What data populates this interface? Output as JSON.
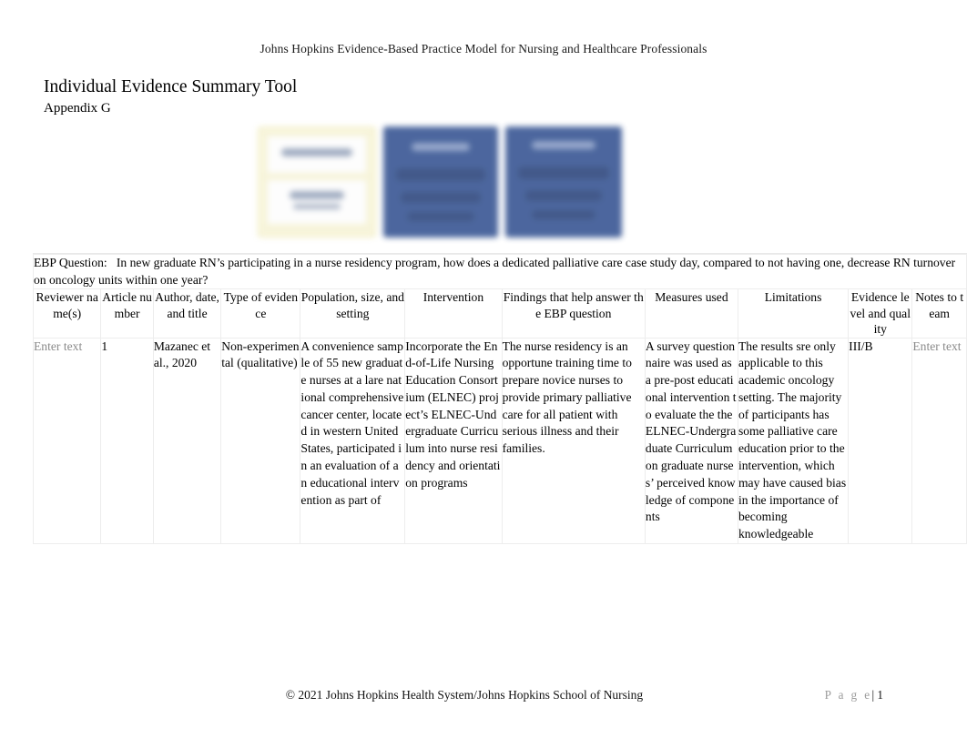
{
  "header": {
    "running_head": "Johns Hopkins Evidence-Based Practice Model for Nursing and Healthcare Professionals"
  },
  "title_block": {
    "title": "Individual Evidence Summary Tool",
    "subtitle": "Appendix G"
  },
  "figure": {
    "name": "jhebp-model-diagram",
    "alt": "Johns Hopkins Evidence-Based Practice model diagram (blurred)",
    "colors": {
      "cream_box": "#f7f4d8",
      "blue_box": "#3d5a96"
    }
  },
  "ebp_question": {
    "label": "EBP Question:",
    "text": "In new graduate RN’s participating in a nurse residency program, how does a dedicated palliative care case study day, compared to not having one, decrease RN turnover on oncology units within one year?"
  },
  "table": {
    "headers": [
      "Reviewer name(s)",
      "Article number",
      "Author, date, and title",
      "Type of evidence",
      "Population, size, and setting",
      "Intervention",
      "Findings that help answer the EBP question",
      "Measures used",
      "Limitations",
      "Evidence level and quality",
      "Notes to team"
    ],
    "rows": [
      {
        "reviewer_names": "Enter text",
        "reviewer_names_is_placeholder": true,
        "article_number": "1",
        "author_date_title": "Mazanec et al., 2020",
        "type_of_evidence": "Non-experimental (qualitative)",
        "population_size_setting": "A convenience sample of 55 new graduate nurses at a lare national comprehensive cancer center, located in western United States, participated in an evaluation of an educational intervention as part of",
        "intervention": "Incorporate the End-of-Life Nursing Education Consortium (ELNEC) project’s ELNEC-Undergraduate Curriculum into nurse residency and orientation programs",
        "findings": "The nurse residency is an opportune training time to prepare novice nurses to provide primary palliative care for all patient with serious illness and their families.",
        "measures_used": "A survey questionnaire was used as a pre-post educational intervention to evaluate the the ELNEC-Undergraduate Curriculum on graduate nurses’ perceived knowledge of components",
        "limitations": "The results sre only applicable to this academic oncology setting. The majority of participants has some palliative care education prior to the intervention, which may have caused bias in the importance of becoming knowledgeable",
        "evidence_level_quality": "III/B",
        "notes_to_team": "Enter text",
        "notes_to_team_is_placeholder": true
      }
    ]
  },
  "footer": {
    "copyright": "© 2021 Johns Hopkins Health System/Johns Hopkins School of Nursing",
    "page_word": "P a g e",
    "page_separator": "|",
    "page_number": "1"
  }
}
